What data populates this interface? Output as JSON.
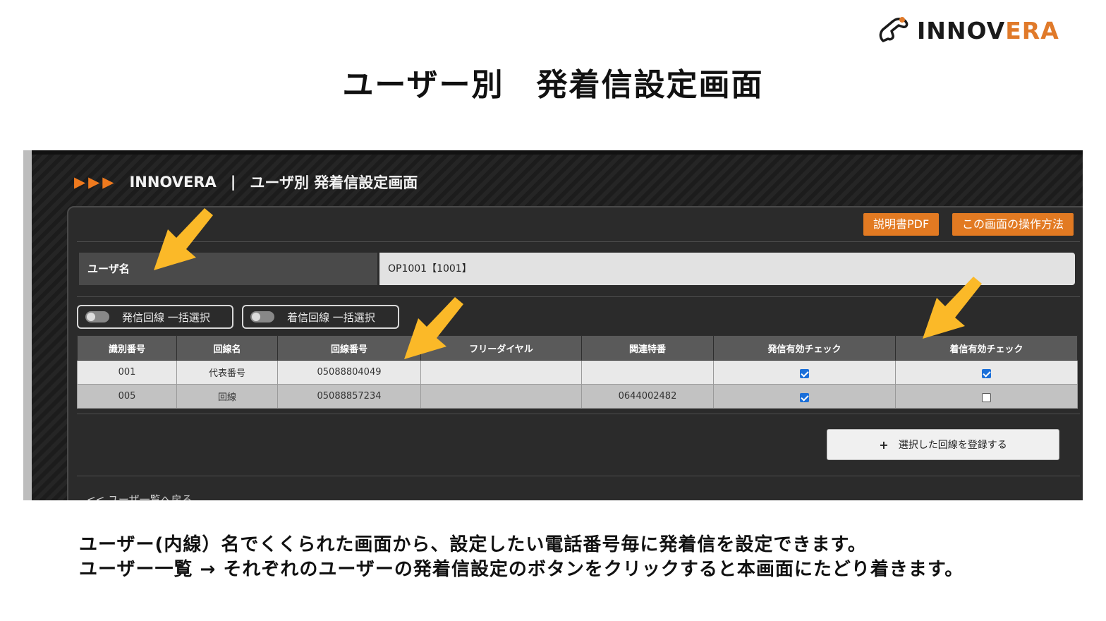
{
  "brand": {
    "name_prefix": "INNOV",
    "name_accent": "ERA",
    "accent_color": "#e07a2a"
  },
  "slide": {
    "title": "ユーザー別　発着信設定画面"
  },
  "app": {
    "header_arrows": "▶▶▶",
    "brand": "INNOVERA",
    "separator": "|",
    "screen_title": "ユーザ別 発着信設定画面",
    "pdf_button": "説明書PDF",
    "howto_button": "この画面の操作方法",
    "user_label": "ユーザ名",
    "user_value": "OP1001【1001】",
    "toggle_outgoing": "発信回線 一括選択",
    "toggle_incoming": "着信回線 一括選択",
    "table": {
      "headers": [
        "識別番号",
        "回線名",
        "回線番号",
        "フリーダイヤル",
        "関連特番",
        "発信有効チェック",
        "着信有効チェック"
      ],
      "rows": [
        {
          "id": "001",
          "name": "代表番号",
          "number": "05088804049",
          "freedial": "",
          "special": "",
          "outgoing": true,
          "incoming": true
        },
        {
          "id": "005",
          "name": "回線",
          "number": "05088857234",
          "freedial": "",
          "special": "0644002482",
          "outgoing": true,
          "incoming": false
        }
      ]
    },
    "register_icon": "+",
    "register_button": "選択した回線を登録する",
    "back_link": "<< ユーザ一覧へ戻る"
  },
  "captions": {
    "line1": "ユーザー(内線）名でくくられた画面から、設定したい電話番号毎に発着信を設定できます。",
    "line2": "ユーザー一覧 → それぞれのユーザーの発着信設定のボタンをクリックすると本画面にたどり着きます。"
  },
  "colors": {
    "orange": "#e27a22",
    "arrow": "#fbb928",
    "checkbox": "#1a6fd9"
  }
}
